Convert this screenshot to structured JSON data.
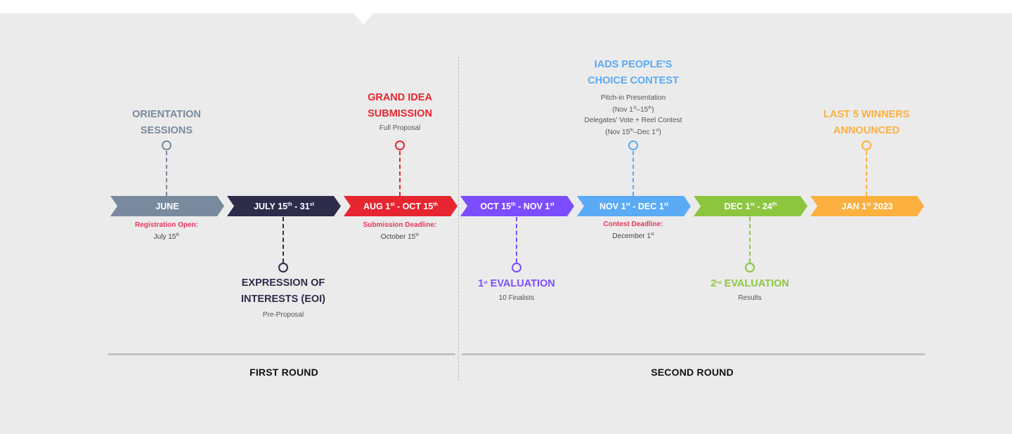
{
  "colors": {
    "slate": "#7a8a9e",
    "navy": "#2d2c4b",
    "red": "#e62530",
    "purple": "#7c4dff",
    "blue": "#5aaaf5",
    "green": "#8cc63f",
    "orange": "#fbb040"
  },
  "timeline": {
    "arrows": [
      {
        "main": "JUNE"
      },
      {
        "main": "JULY 15",
        "sup1": "th",
        "mid": " - 31",
        "sup2": "st"
      },
      {
        "main": "AUG  1",
        "sup1": "st",
        "mid": " - OCT 15",
        "sup2": "th"
      },
      {
        "main": "OCT 15",
        "sup1": "th",
        "mid": " - NOV  1",
        "sup2": "st"
      },
      {
        "main": "NOV  1",
        "sup1": "st",
        "mid": "  - DEC 1",
        "sup2": "st"
      },
      {
        "main": "DEC 1",
        "sup1": "st",
        "mid": " -  24",
        "sup2": "th"
      },
      {
        "main": "JAN 1",
        "sup1": "st",
        "mid": " 2023",
        "sup2": ""
      }
    ]
  },
  "milestones": {
    "orientation": {
      "line1": "ORIENTATION",
      "line2": "SESSIONS"
    },
    "eoi": {
      "line1": "EXPRESSION OF",
      "line2": "INTERESTS (EOI)",
      "sub": "Pre-Proposal"
    },
    "grand_idea": {
      "line1": "GRAND IDEA",
      "line2": "SUBMISSION",
      "sub": "Full Proposal"
    },
    "first_eval": {
      "sup": "st",
      "pre": "1",
      "line1": " EVALUATION",
      "sub": "10 Finalists"
    },
    "peoples_choice": {
      "line1": "IADS PEOPLE'S",
      "line2": "CHOICE CONTEST",
      "sub1": "Pitch-in Presentation",
      "sub2a": "(Nov 1",
      "sub2sup1": "st",
      "sub2b": "–15",
      "sub2sup2": "th",
      "sub2c": ")",
      "sub3": "Delegates' Vote + Reel Contest",
      "sub4a": "(Nov 15",
      "sub4sup1": "th",
      "sub4b": "–Dec 1",
      "sub4sup2": "st",
      "sub4c": ")"
    },
    "second_eval": {
      "pre": "2",
      "sup": "nd",
      "line1": " EVALUATION",
      "sub": "Results"
    },
    "winners": {
      "line1": "LAST 5 WINNERS",
      "line2": "ANNOUNCED"
    }
  },
  "notes": {
    "registration": {
      "label": "Registration Open:",
      "value": "July 15",
      "sup": "th"
    },
    "submission": {
      "label": "Submission Deadline:",
      "value": "October 15",
      "sup": "th"
    },
    "contest": {
      "label": "Contest Deadline:",
      "value": "December 1",
      "sup": "st"
    }
  },
  "rounds": {
    "first": "FIRST ROUND",
    "second": "SECOND ROUND"
  }
}
